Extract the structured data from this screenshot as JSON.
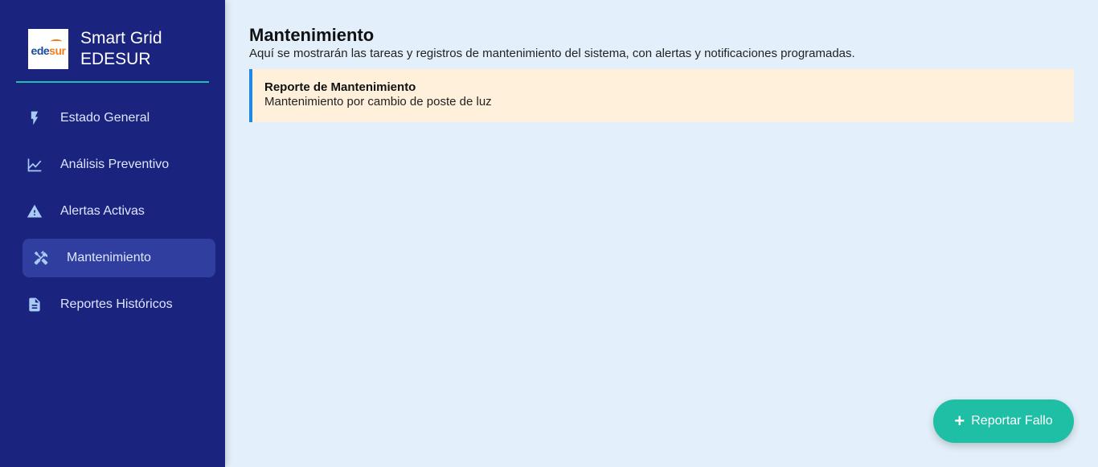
{
  "sidebar": {
    "brand": {
      "logo_text_1": "ede",
      "logo_text_2": "sur",
      "title_line1": "Smart Grid",
      "title_line2": "EDESUR"
    },
    "items": [
      {
        "label": "Estado General",
        "icon": "bolt-icon"
      },
      {
        "label": "Análisis Preventivo",
        "icon": "line-chart-icon"
      },
      {
        "label": "Alertas Activas",
        "icon": "warning-icon"
      },
      {
        "label": "Mantenimiento",
        "icon": "tools-icon",
        "active": true
      },
      {
        "label": "Reportes Históricos",
        "icon": "document-icon"
      }
    ]
  },
  "main": {
    "title": "Mantenimiento",
    "description": "Aquí se mostrarán las tareas y registros de mantenimiento del sistema, con alertas y notificaciones programadas.",
    "card": {
      "title": "Reporte de Mantenimiento",
      "body": "Mantenimiento por cambio de poste de luz"
    },
    "fab": {
      "icon": "+",
      "label": "Reportar Fallo"
    }
  },
  "colors": {
    "sidebar_bg": "#1a237e",
    "accent_teal": "#1fbfa6",
    "card_bg": "#fff0dc",
    "card_border": "#1e88e5",
    "main_bg": "#e3f0fb"
  }
}
